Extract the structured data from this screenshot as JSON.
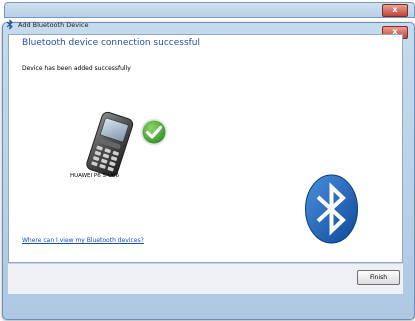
{
  "background_window": {
    "close_label": "x"
  },
  "dialog": {
    "title": "Add Bluetooth Device",
    "close_label": "x",
    "heading": "Bluetooth device connection successful",
    "message": "Device has been added successfully",
    "device_name": "HUAWEI P6 S-U06",
    "help_link": "Where can I view my Bluetooth devices?",
    "finish_label": "Finish"
  },
  "icons": [
    "bluetooth-title-icon",
    "phone-icon",
    "success-check-icon",
    "bluetooth-logo-icon"
  ],
  "colors": {
    "heading": "#1f4e9e",
    "link": "#1a4fa8",
    "check_green": "#3a9a2a",
    "bluetooth_blue": "#1b63b8"
  }
}
